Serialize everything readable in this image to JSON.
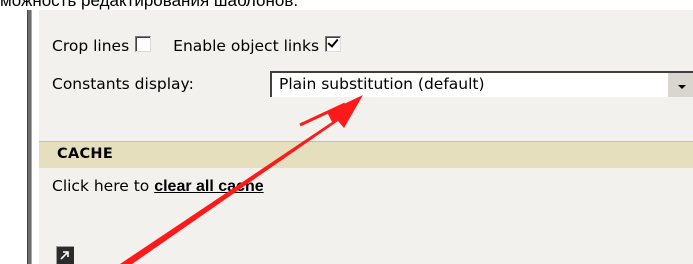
{
  "caption": {
    "text": "можность редактирования шаблонов."
  },
  "options": {
    "crop_lines_label": "Crop lines",
    "crop_lines_checked": false,
    "enable_links_label": "Enable object links",
    "enable_links_checked": true,
    "constants_label": "Constants display:",
    "constants_selected": "Plain substitution (default)"
  },
  "cache_section": {
    "title": "CACHE",
    "prefix_text": "Click here to ",
    "link_text": "clear all cache"
  },
  "icons": {
    "corner_button": "expand-arrow-icon",
    "annotation": "red-arrow-annotation"
  },
  "colors": {
    "panel_bg": "#f3f1ed",
    "section_header_bg": "#e6dfbe",
    "annotation_red": "#ff1a1a"
  }
}
